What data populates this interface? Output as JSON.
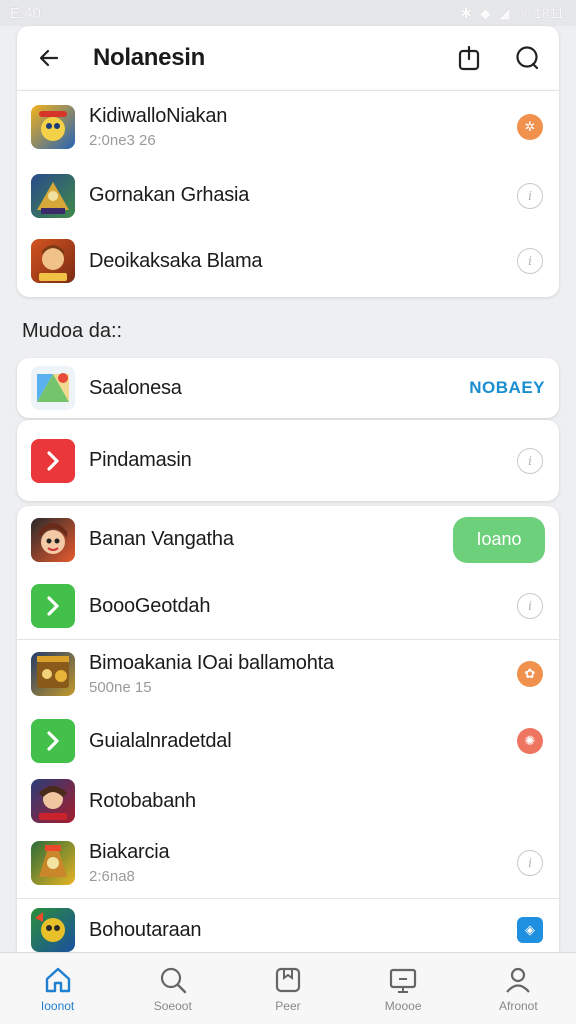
{
  "status_bar": {
    "time": "E:40",
    "right_text": "% 1811"
  },
  "header": {
    "title": "Nolanesin"
  },
  "top_list": [
    {
      "name": "KidiwalloNiakan",
      "sub": "2:0ne3 26",
      "action": "badge",
      "badge_color": "#f0914e",
      "icon_colors": [
        "#f3b21c",
        "#2563b6"
      ]
    },
    {
      "name": "Gornakan Grhasia",
      "action": "info",
      "icon_colors": [
        "#2a4a8a",
        "#d6a83a"
      ]
    },
    {
      "name": "Deoikaksaka Blama",
      "action": "info",
      "icon_colors": [
        "#d3541f",
        "#f1c146"
      ]
    }
  ],
  "section_label": "Mudoa da::",
  "section_row": {
    "name": "Saalonesa",
    "link": "NOBAEY"
  },
  "second_list": [
    {
      "name": "Pindamasin",
      "action": "info",
      "icon_color": "#e9373a"
    }
  ],
  "main_list": [
    {
      "name": "Banan Vangatha",
      "action": "pill",
      "pill_label": "Ioano",
      "icon_colors": [
        "#e85a2f",
        "#2a2a2a"
      ]
    },
    {
      "name": "BoooGeotdah",
      "action": "info",
      "icon_color": "#43c04a"
    },
    {
      "name": "Bimoakania IOai ballamohta",
      "sub": "500ne 15",
      "action": "badge",
      "badge_color": "#f0914e",
      "icon_colors": [
        "#c49a2a",
        "#243b6b"
      ]
    },
    {
      "name": "Guialalnradetdal",
      "action": "badge",
      "badge_color": "#ee7660",
      "icon_color": "#43c04a"
    },
    {
      "name": "Rotobabanh",
      "action": "none",
      "icon_colors": [
        "#a61d2c",
        "#2a3d7a"
      ]
    },
    {
      "name": "Biakarcia",
      "sub": "2:6na8",
      "action": "info",
      "icon_colors": [
        "#e8b421",
        "#2b6b3a"
      ]
    },
    {
      "name": "Bohoutaraan",
      "action": "badge-sq",
      "badge_color": "#1f8fe0",
      "icon_colors": [
        "#2b8f3a",
        "#e8c02a"
      ]
    }
  ],
  "tabs": [
    {
      "label": "Ioonot",
      "icon": "home-icon",
      "active": true
    },
    {
      "label": "Soeoot",
      "icon": "search-icon",
      "active": false
    },
    {
      "label": "Peer",
      "icon": "library-icon",
      "active": false
    },
    {
      "label": "Moooe",
      "icon": "monitor-icon",
      "active": false
    },
    {
      "label": "Afronot",
      "icon": "person-icon",
      "active": false
    }
  ],
  "colors": {
    "accent": "#1f7fd0",
    "green": "#6dd07a",
    "link": "#1a8fd0"
  }
}
